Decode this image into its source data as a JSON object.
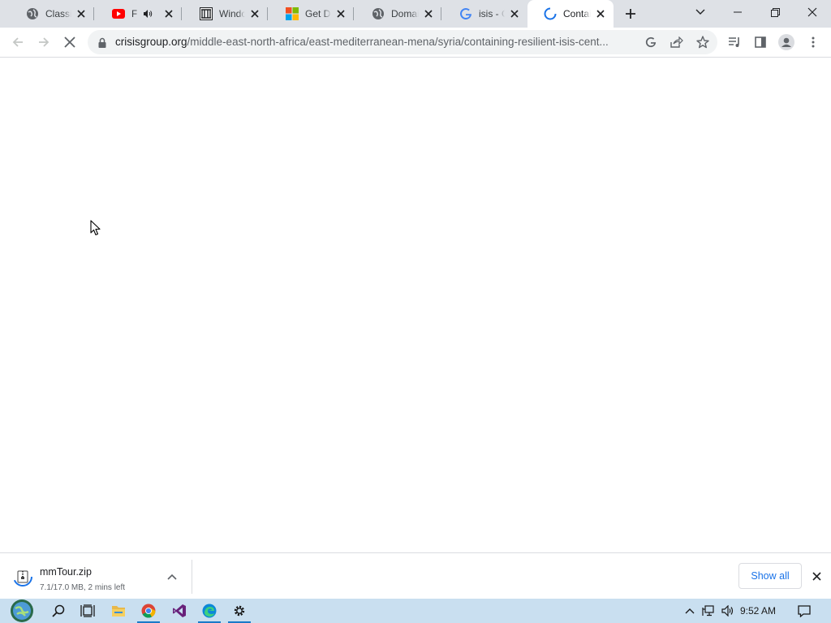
{
  "browser": {
    "tabs": [
      {
        "title": "ClassicShell",
        "icon": "globe-icon"
      },
      {
        "title": "Full",
        "icon": "youtube-icon",
        "audio": true
      },
      {
        "title": "Windows",
        "icon": "library-icon"
      },
      {
        "title": "Get Dev",
        "icon": "microsoft-logo-icon"
      },
      {
        "title": "Domain",
        "icon": "globe-icon"
      },
      {
        "title": "isis - Go",
        "icon": "google-icon"
      },
      {
        "title": "Contain",
        "icon": "loading-spinner-icon",
        "active": true
      }
    ],
    "address": {
      "host": "crisisgroup.org",
      "path": "/middle-east-north-africa/east-mediterranean-mena/syria/containing-resilient-isis-cent..."
    }
  },
  "downloads": {
    "item": {
      "filename": "mmTour.zip",
      "status": "7.1/17.0 MB, 2 mins left"
    },
    "show_all_label": "Show all"
  },
  "taskbar": {
    "clock": "9:52 AM",
    "apps": [
      "start-orb-icon",
      "search-icon",
      "task-view-icon",
      "file-explorer-icon",
      "chrome-icon",
      "visual-studio-icon",
      "edge-icon",
      "settings-icon"
    ]
  },
  "colors": {
    "accent": "#1a73e8",
    "tabstrip": "#dee1e6",
    "taskbar": "#c9dff0"
  }
}
